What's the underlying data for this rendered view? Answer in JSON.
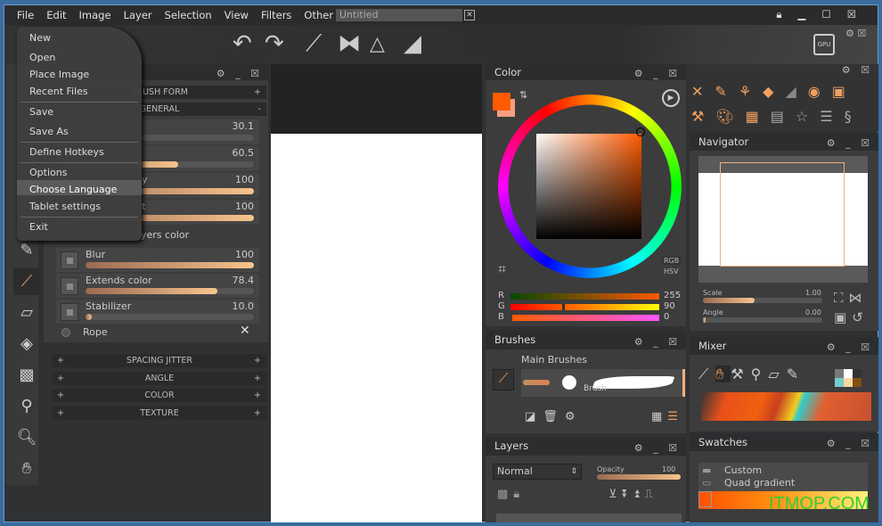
{
  "menubar": {
    "items": [
      "File",
      "Edit",
      "Image",
      "Layer",
      "Selection",
      "View",
      "Filters",
      "Other"
    ],
    "document_tab": "Untitled"
  },
  "file_menu": {
    "items": [
      "New",
      "Open",
      "Place Image",
      "Recent Files",
      "Save",
      "Save As",
      "Define Hotkeys",
      "Options",
      "Choose Language",
      "Tablet settings",
      "Exit"
    ],
    "highlighted": "Choose Language"
  },
  "toolbar": {
    "gpu_label": "GPU"
  },
  "brush_panel": {
    "sections_top": [
      "BRUSH FORM",
      "GENERAL"
    ],
    "sliders": [
      {
        "value": "30.1",
        "fill": 0
      },
      {
        "value": "60.5",
        "fill": 0.605
      },
      {
        "label": "y",
        "value": "100",
        "fill": 1
      },
      {
        "label": "t",
        "value": "100",
        "fill": 1
      }
    ],
    "layers_color_label": "yers color",
    "options": [
      {
        "label": "Blur",
        "value": "100",
        "fill": 1
      },
      {
        "label": "Extends color",
        "value": "78.4",
        "fill": 0.784
      },
      {
        "label": "Stabilizer",
        "value": "10.0",
        "fill": 0.02
      }
    ],
    "rope_label": "Rope",
    "sections_bottom": [
      "SPACING JITTER",
      "ANGLE",
      "COLOR",
      "TEXTURE"
    ]
  },
  "color_panel": {
    "title": "Color",
    "primary": "#ff5a00",
    "secondary": "#f5a080",
    "mode_rgb": "RGB",
    "mode_hsv": "HSV",
    "channels": [
      {
        "label": "R",
        "value": "255"
      },
      {
        "label": "G",
        "value": "90"
      },
      {
        "label": "B",
        "value": "0"
      }
    ]
  },
  "brushes_panel": {
    "title": "Brushes",
    "group": "Main Brushes",
    "brush_name": "Brush"
  },
  "layers_panel": {
    "title": "Layers",
    "blend_mode": "Normal",
    "opacity_label": "Opacity",
    "opacity_value": "100",
    "opacity": 1
  },
  "navigator_panel": {
    "title": "Navigator",
    "scale_label": "Scale",
    "scale_value": "1.00",
    "angle_label": "Angle",
    "angle_value": "0.00"
  },
  "mixer_panel": {
    "title": "Mixer"
  },
  "swatches_panel": {
    "title": "Swatches",
    "items": [
      "Custom",
      "Quad gradient"
    ]
  },
  "watermark": "ITMOP.COM"
}
